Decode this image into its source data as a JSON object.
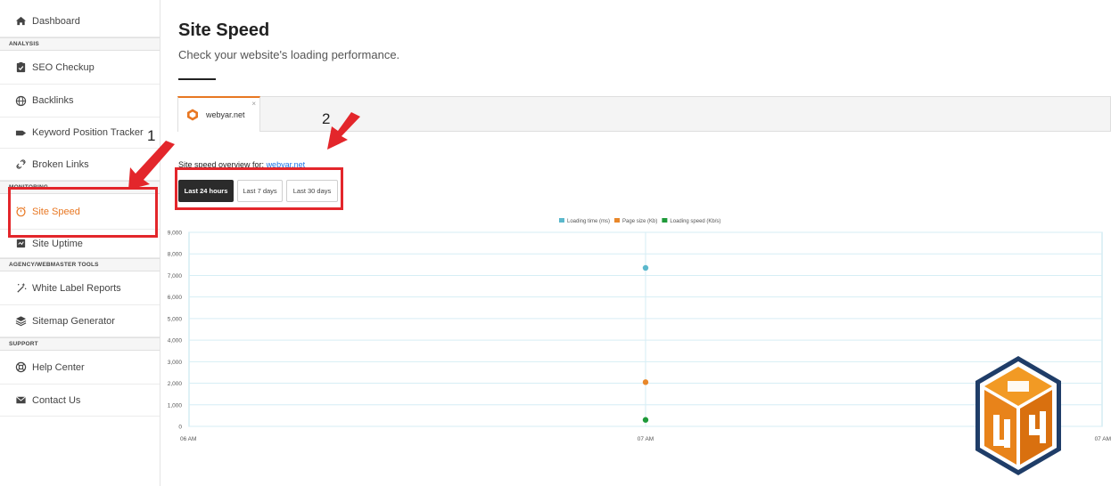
{
  "sidebar": {
    "dashboard": "Dashboard",
    "section_analysis": "ANALYSIS",
    "seo_checkup": "SEO Checkup",
    "backlinks": "Backlinks",
    "keyword_tracker": "Keyword Position Tracker",
    "broken_links": "Broken Links",
    "section_monitoring": "MONITORING",
    "site_speed": "Site Speed",
    "site_uptime": "Site Uptime",
    "section_agency": "AGENCY/WEBMASTER TOOLS",
    "white_label": "White Label Reports",
    "sitemap": "Sitemap Generator",
    "section_support": "SUPPORT",
    "help_center": "Help Center",
    "contact_us": "Contact Us"
  },
  "main": {
    "title": "Site Speed",
    "subtitle": "Check your website's loading performance.",
    "tab_domain": "webyar.net",
    "tab_close": "×",
    "overview_label": "Site speed overview for: ",
    "overview_domain": "webyar.net",
    "ranges": [
      "Last 24 hours",
      "Last 7 days",
      "Last 30 days"
    ],
    "selected_range": "Last 24 hours"
  },
  "annotations": {
    "one": "1",
    "two": "2"
  },
  "colors": {
    "accent": "#e87722",
    "annotation_red": "#e3262b",
    "loading_time": "#5bb8cc",
    "page_size": "#e8872a",
    "loading_speed": "#1f9a3a"
  },
  "chart_data": {
    "type": "scatter",
    "x_categories": [
      "06 AM",
      "07 AM",
      "07 AM"
    ],
    "ylim": [
      0,
      9000
    ],
    "y_ticks": [
      "0",
      "1,000",
      "2,000",
      "3,000",
      "4,000",
      "5,000",
      "6,000",
      "7,000",
      "8,000",
      "9,000"
    ],
    "grid": true,
    "legend_position": "top",
    "series": [
      {
        "name": "Loading time (ms)",
        "color": "#5bb8cc",
        "points": [
          {
            "x": "07 AM",
            "y": 7350
          }
        ]
      },
      {
        "name": "Page size (Kb)",
        "color": "#e8872a",
        "points": [
          {
            "x": "07 AM",
            "y": 2050
          }
        ]
      },
      {
        "name": "Loading speed (Kb/s)",
        "color": "#1f9a3a",
        "points": [
          {
            "x": "07 AM",
            "y": 300
          }
        ]
      }
    ]
  }
}
